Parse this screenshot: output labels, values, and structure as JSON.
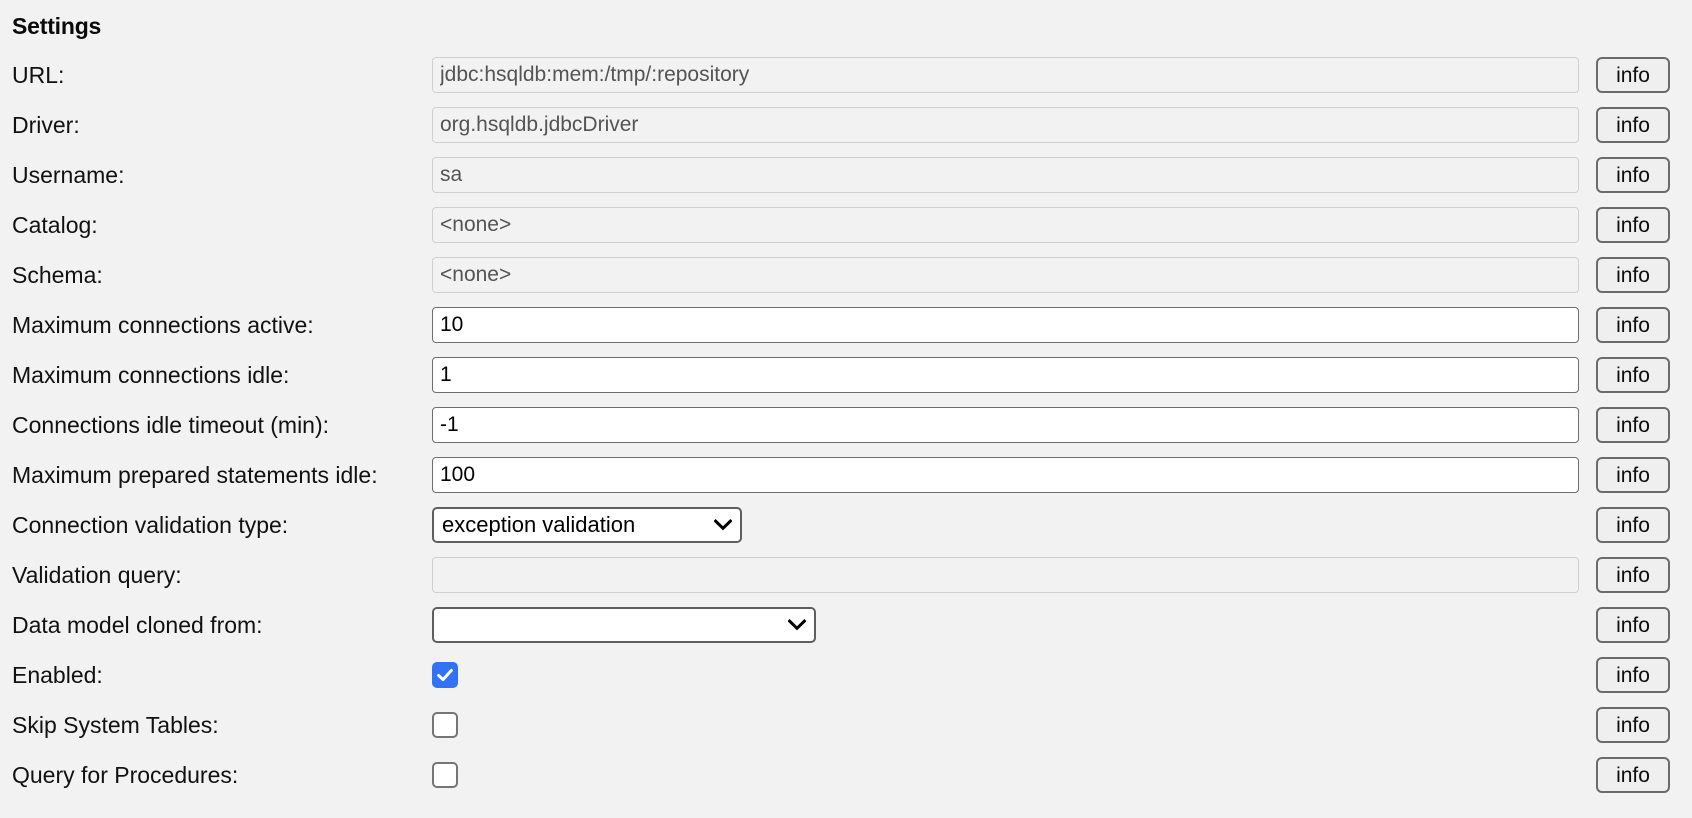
{
  "page": {
    "title": "Settings"
  },
  "info_button_label": "info",
  "colors": {
    "background": "#f2f2f2",
    "checkbox_checked": "#3273f5",
    "input_border_enabled": "#6e6e6e",
    "input_border_disabled": "#d0d0d0",
    "disabled_text": "#545454"
  },
  "rows": [
    {
      "label": "URL:",
      "type": "text",
      "value": "jdbc:hsqldb:mem:/tmp/:repository",
      "enabled": false,
      "name": "url",
      "info": "info"
    },
    {
      "label": "Driver:",
      "type": "text",
      "value": "org.hsqldb.jdbcDriver",
      "enabled": false,
      "name": "driver",
      "info": "info"
    },
    {
      "label": "Username:",
      "type": "text",
      "value": "sa",
      "enabled": false,
      "name": "username",
      "info": "info"
    },
    {
      "label": "Catalog:",
      "type": "text",
      "value": "<none>",
      "enabled": false,
      "name": "catalog",
      "info": "info"
    },
    {
      "label": "Schema:",
      "type": "text",
      "value": "<none>",
      "enabled": false,
      "name": "schema",
      "info": "info"
    },
    {
      "label": "Maximum connections active:",
      "type": "text",
      "value": "10",
      "enabled": true,
      "name": "maximum-connections-active",
      "info": "info"
    },
    {
      "label": "Maximum connections idle:",
      "type": "text",
      "value": "1",
      "enabled": true,
      "name": "maximum-connections-idle",
      "info": "info"
    },
    {
      "label": "Connections idle timeout (min):",
      "type": "text",
      "value": "-1",
      "enabled": true,
      "name": "connections-idle-timeout",
      "info": "info"
    },
    {
      "label": "Maximum prepared statements idle:",
      "type": "text",
      "value": "100",
      "enabled": true,
      "name": "maximum-prepared-statements-idle",
      "info": "info"
    },
    {
      "label": "Connection validation type:",
      "type": "select",
      "value": "exception validation",
      "enabled": true,
      "name": "connection-validation-type",
      "info": "info"
    },
    {
      "label": "Validation query:",
      "type": "text",
      "value": "",
      "enabled": false,
      "name": "validation-query",
      "info": "info"
    },
    {
      "label": "Data model cloned from:",
      "type": "select",
      "value": "",
      "enabled": true,
      "name": "data-model-cloned-from",
      "info": "info"
    },
    {
      "label": "Enabled:",
      "type": "checkbox",
      "checked": true,
      "name": "enabled",
      "info": "info"
    },
    {
      "label": "Skip System Tables:",
      "type": "checkbox",
      "checked": false,
      "name": "skip-system-tables",
      "info": "info"
    },
    {
      "label": "Query for Procedures:",
      "type": "checkbox",
      "checked": false,
      "name": "query-for-procedures",
      "info": "info"
    }
  ]
}
